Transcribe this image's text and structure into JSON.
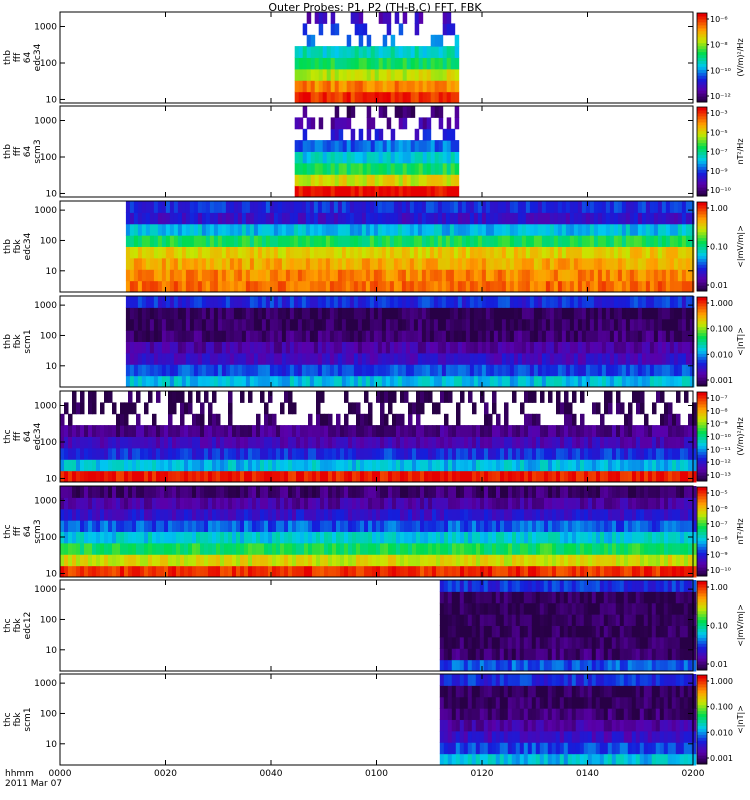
{
  "title": "Outer Probes: P1, P2 (TH-B,C) FFT, FBK",
  "time_axis": {
    "row1": "hhmm",
    "row2": "2011 Mar 07",
    "ticks": [
      "0000",
      "0020",
      "0040",
      "0100",
      "0120",
      "0140",
      "0200"
    ],
    "range_minutes": [
      0,
      120
    ]
  },
  "chart_data": [
    {
      "type": "heatmap",
      "ylabel": [
        "thb",
        "fff",
        "64",
        "edc34"
      ],
      "ylog": true,
      "ylim": [
        8,
        2500
      ],
      "yticks": [
        "1000",
        "100",
        "10"
      ],
      "x_extent_minutes": [
        44.5,
        75.5
      ],
      "colorbar": {
        "label": "(V/m)²/Hz",
        "ticks": [
          "10⁻⁶",
          "10⁻⁸",
          "10⁻¹⁰",
          "10⁻¹²"
        ]
      }
    },
    {
      "type": "heatmap",
      "ylabel": [
        "thb",
        "fff",
        "64",
        "scm3"
      ],
      "ylog": true,
      "ylim": [
        8,
        2500
      ],
      "yticks": [
        "1000",
        "100",
        "10"
      ],
      "x_extent_minutes": [
        44.5,
        75.5
      ],
      "colorbar": {
        "label": "nT²/Hz",
        "ticks": [
          "10⁻³",
          "10⁻⁵",
          "10⁻⁷",
          "10⁻⁹",
          "10⁻¹⁰"
        ]
      }
    },
    {
      "type": "heatmap",
      "ylabel": [
        "thb",
        "fbk",
        "edc34"
      ],
      "ylog": true,
      "ylim": [
        2,
        2000
      ],
      "yticks": [
        "1000",
        "100",
        "10"
      ],
      "x_extent_minutes": [
        12.5,
        120
      ],
      "colorbar": {
        "label": "<|mV/m|>",
        "ticks": [
          "1.00",
          "0.10",
          "0.01"
        ]
      }
    },
    {
      "type": "heatmap",
      "ylabel": [
        "thb",
        "fbk",
        "scm1"
      ],
      "ylog": true,
      "ylim": [
        2,
        2000
      ],
      "yticks": [
        "1000",
        "100",
        "10"
      ],
      "x_extent_minutes": [
        12.5,
        120
      ],
      "colorbar": {
        "label": "<|nT|>",
        "ticks": [
          "1.000",
          "0.100",
          "0.010",
          "0.001"
        ]
      }
    },
    {
      "type": "heatmap",
      "ylabel": [
        "thc",
        "fff",
        "64",
        "edc34"
      ],
      "ylog": true,
      "ylim": [
        8,
        2500
      ],
      "yticks": [
        "1000",
        "100",
        "10"
      ],
      "x_extent_minutes": [
        0,
        120
      ],
      "colorbar": {
        "label": "(V/m)²/Hz",
        "ticks": [
          "10⁻⁷",
          "10⁻⁸",
          "10⁻⁹",
          "10⁻¹⁰",
          "10⁻¹¹",
          "10⁻¹²",
          "10⁻¹³"
        ]
      }
    },
    {
      "type": "heatmap",
      "ylabel": [
        "thc",
        "fff",
        "64",
        "scm3"
      ],
      "ylog": true,
      "ylim": [
        8,
        2500
      ],
      "yticks": [
        "1000",
        "100",
        "10"
      ],
      "x_extent_minutes": [
        0,
        120
      ],
      "colorbar": {
        "label": "nT²/Hz",
        "ticks": [
          "10⁻⁵",
          "10⁻⁶",
          "10⁻⁷",
          "10⁻⁸",
          "10⁻⁹",
          "10⁻¹⁰"
        ]
      }
    },
    {
      "type": "heatmap",
      "ylabel": [
        "thc",
        "fbk",
        "edc12"
      ],
      "ylog": true,
      "ylim": [
        2,
        2000
      ],
      "yticks": [
        "1000",
        "100",
        "10"
      ],
      "x_extent_minutes": [
        72,
        120
      ],
      "colorbar": {
        "label": "<|mV/m|>",
        "ticks": [
          "1.00",
          "0.10",
          "0.01"
        ]
      }
    },
    {
      "type": "heatmap",
      "ylabel": [
        "thc",
        "fbk",
        "scm1"
      ],
      "ylog": true,
      "ylim": [
        2,
        2000
      ],
      "yticks": [
        "1000",
        "100",
        "10"
      ],
      "x_extent_minutes": [
        72,
        120
      ],
      "colorbar": {
        "label": "<|nT|>",
        "ticks": [
          "1.000",
          "0.100",
          "0.010",
          "0.001"
        ]
      }
    }
  ]
}
